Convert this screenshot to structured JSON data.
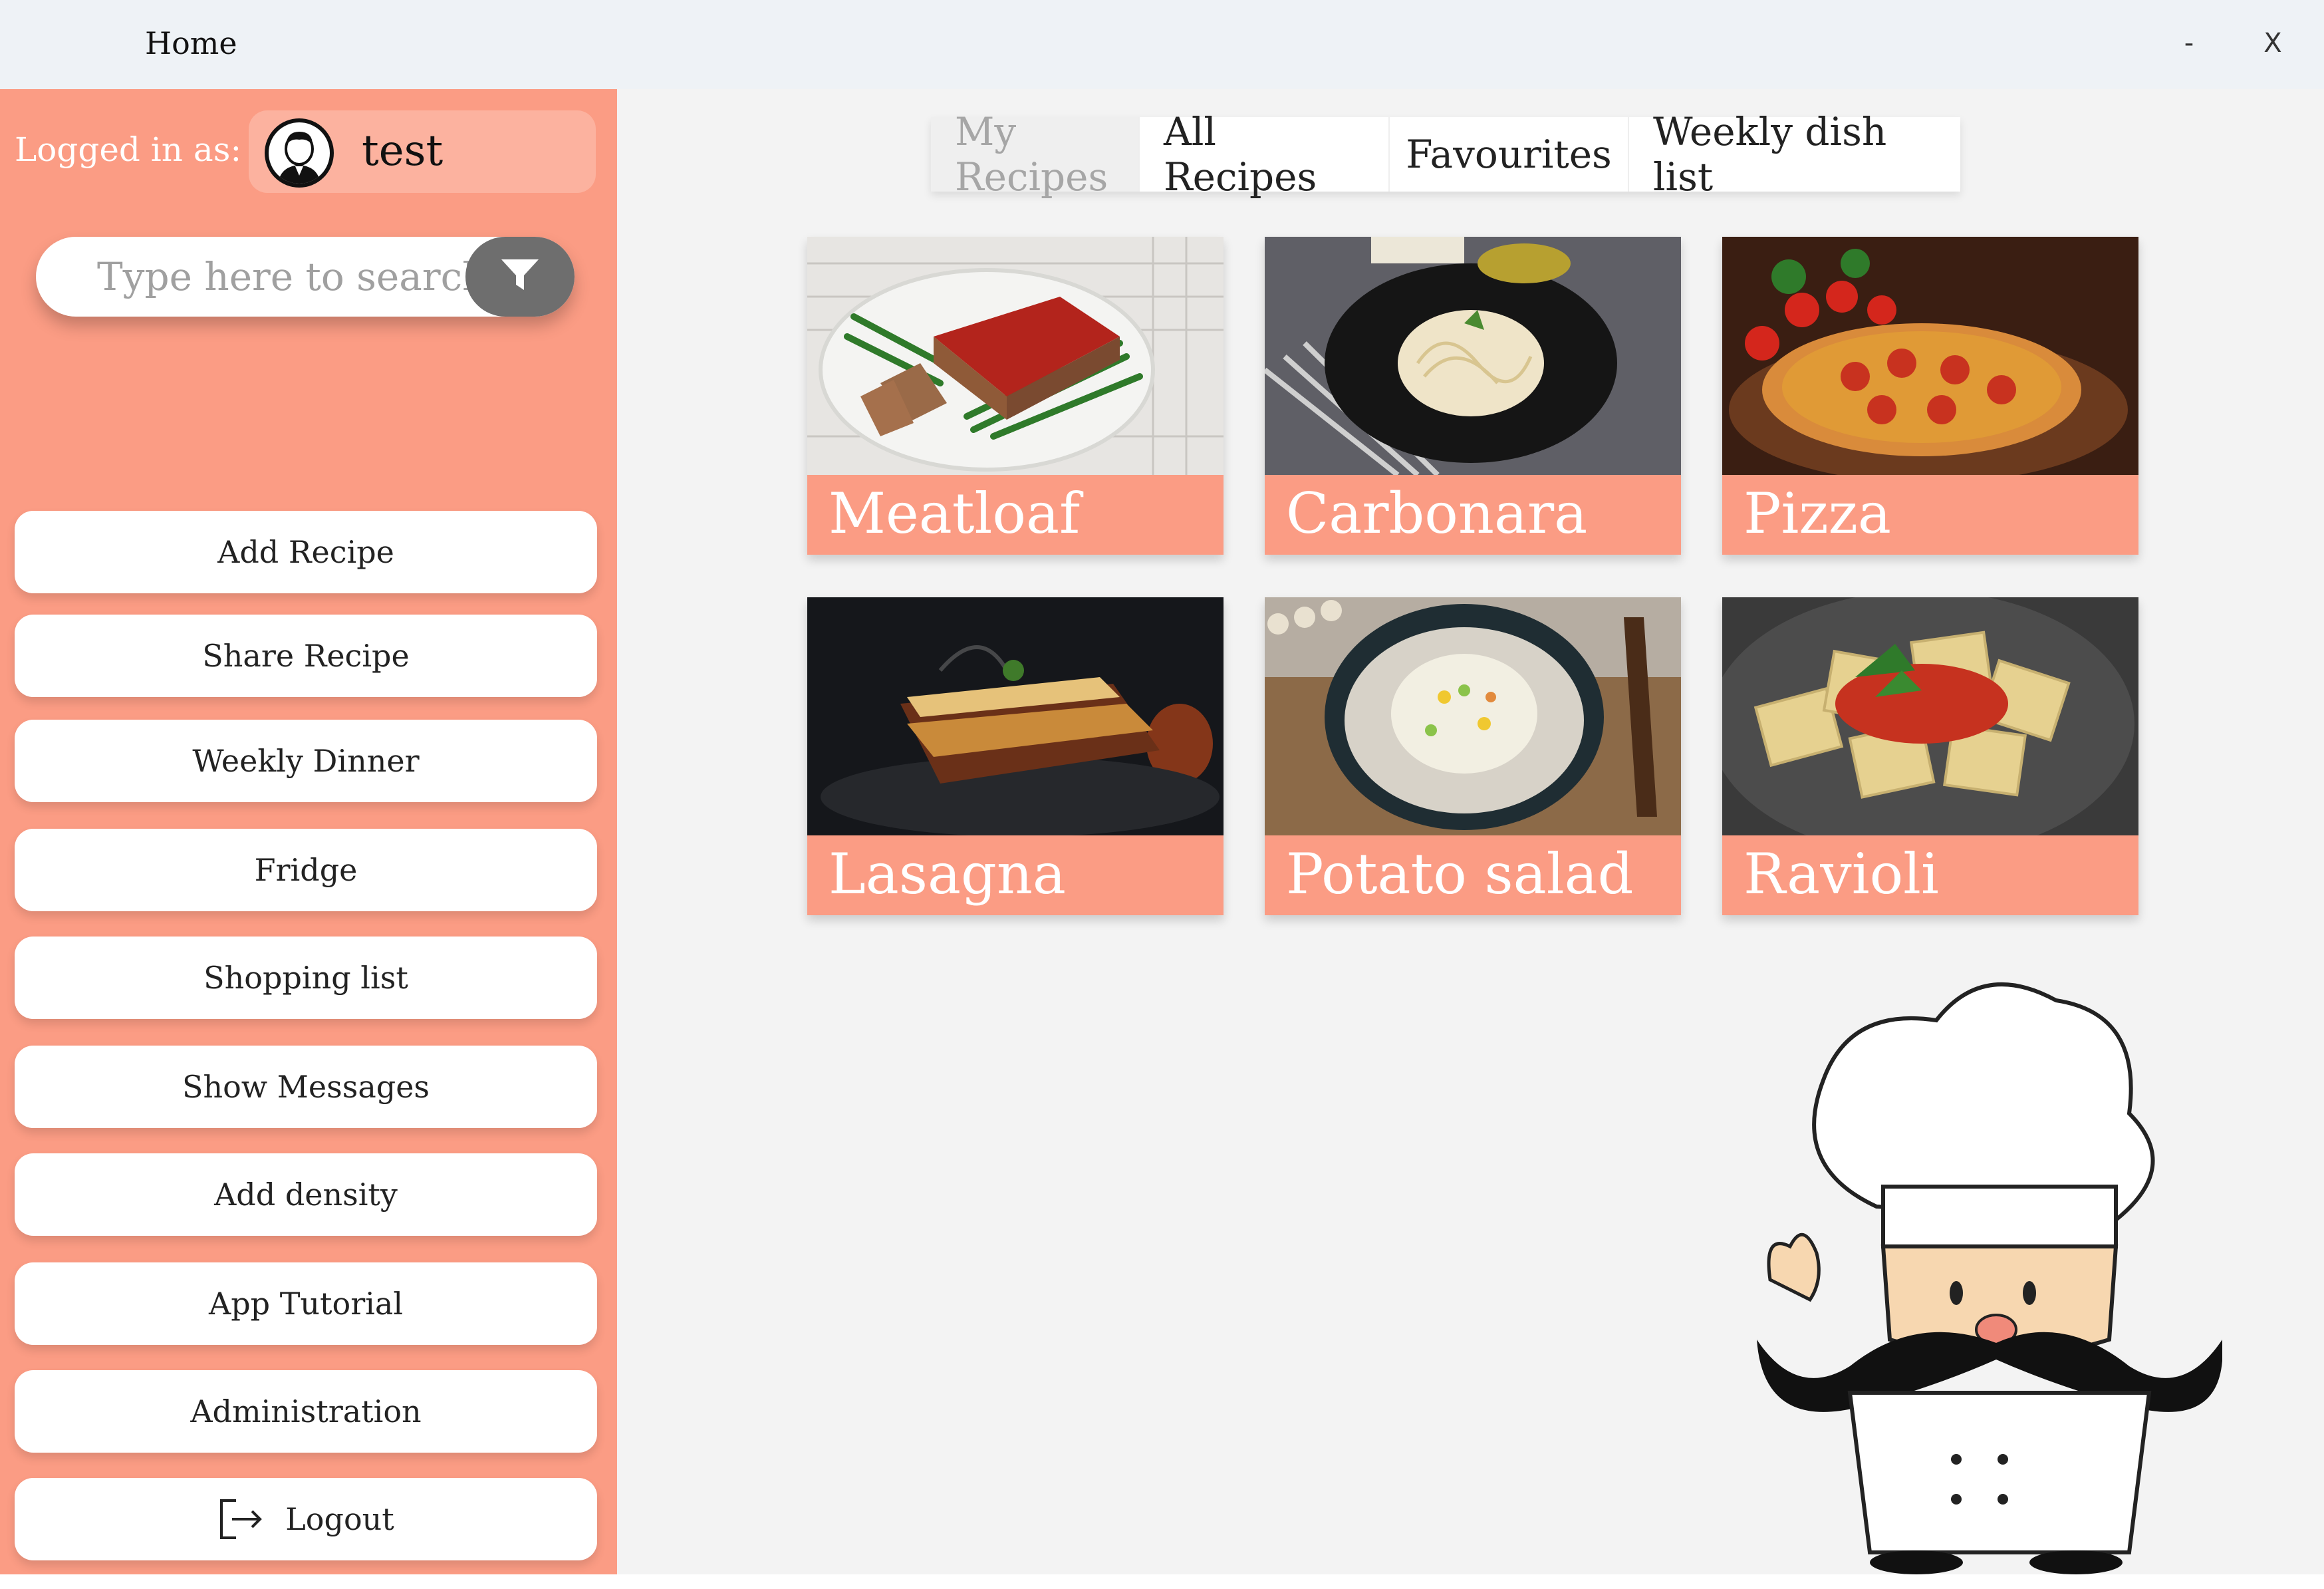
{
  "window": {
    "title": "Home",
    "minimize_label": "-",
    "close_label": "X"
  },
  "sidebar": {
    "logged_in_label": "Logged in as:",
    "username": "test",
    "search_placeholder": "Type here to search",
    "buttons": [
      {
        "label": "Add Recipe"
      },
      {
        "label": "Share Recipe"
      },
      {
        "label": "Weekly Dinner"
      },
      {
        "label": "Fridge"
      },
      {
        "label": "Shopping list"
      },
      {
        "label": "Show Messages"
      },
      {
        "label": "Add density"
      },
      {
        "label": "App Tutorial"
      },
      {
        "label": "Administration"
      },
      {
        "label": "Logout",
        "icon": "logout-icon"
      }
    ]
  },
  "tabs": [
    {
      "label": "My Recipes",
      "active": true
    },
    {
      "label": "All Recipes",
      "active": false
    },
    {
      "label": "Favourites",
      "active": false
    },
    {
      "label": "Weekly dish list",
      "active": false
    }
  ],
  "recipes": [
    {
      "name": "Meatloaf"
    },
    {
      "name": "Carbonara"
    },
    {
      "name": "Pizza"
    },
    {
      "name": "Lasagna"
    },
    {
      "name": "Potato salad"
    },
    {
      "name": "Ravioli"
    }
  ],
  "colors": {
    "sidebar": "#fb9c84",
    "card_label": "#fb9c84",
    "filter_button": "#6e6e6e",
    "background": "#f3f3f3"
  },
  "icons": {
    "filter": "filter-icon",
    "avatar": "user-avatar-icon",
    "logout": "logout-icon",
    "mascot": "chef-mascot"
  }
}
